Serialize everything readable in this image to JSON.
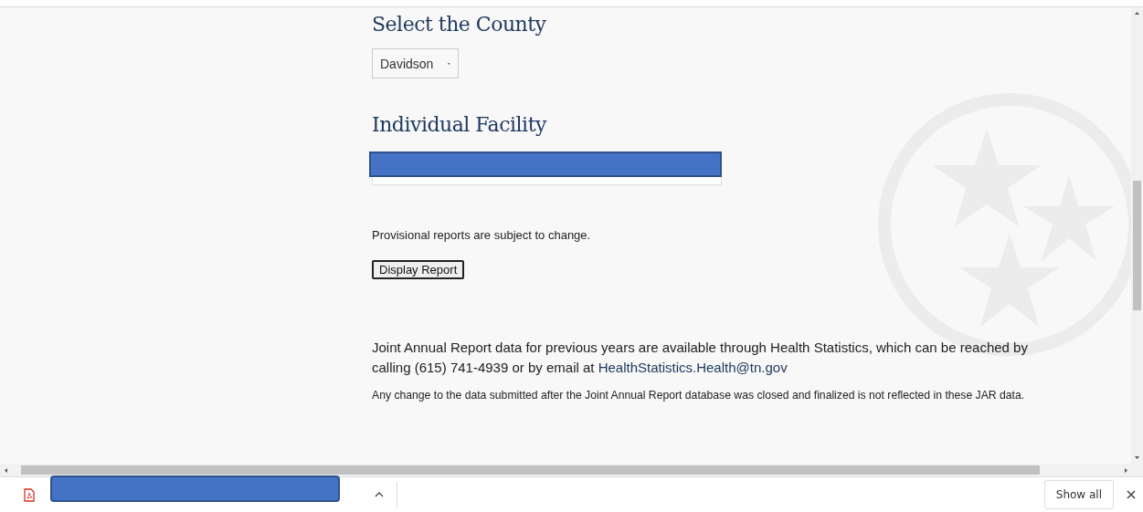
{
  "form": {
    "county_heading": "Select the County",
    "county_select": {
      "value": "Davidson"
    },
    "facility_heading": "Individual Facility",
    "provisional_note": "Provisional reports are subject to change.",
    "display_button": "Display Report"
  },
  "info": {
    "availability_text": "Joint Annual Report data for previous years are available through Health Statistics, which can be reached by calling (615) 741-4939 or by email at",
    "email_link": "HealthStatistics.Health@tn.gov",
    "disclaimer": "Any change to the data submitted after the Joint Annual Report database was closed and finalized is not reflected in these JAR data."
  },
  "download_bar": {
    "show_all": "Show all"
  }
}
